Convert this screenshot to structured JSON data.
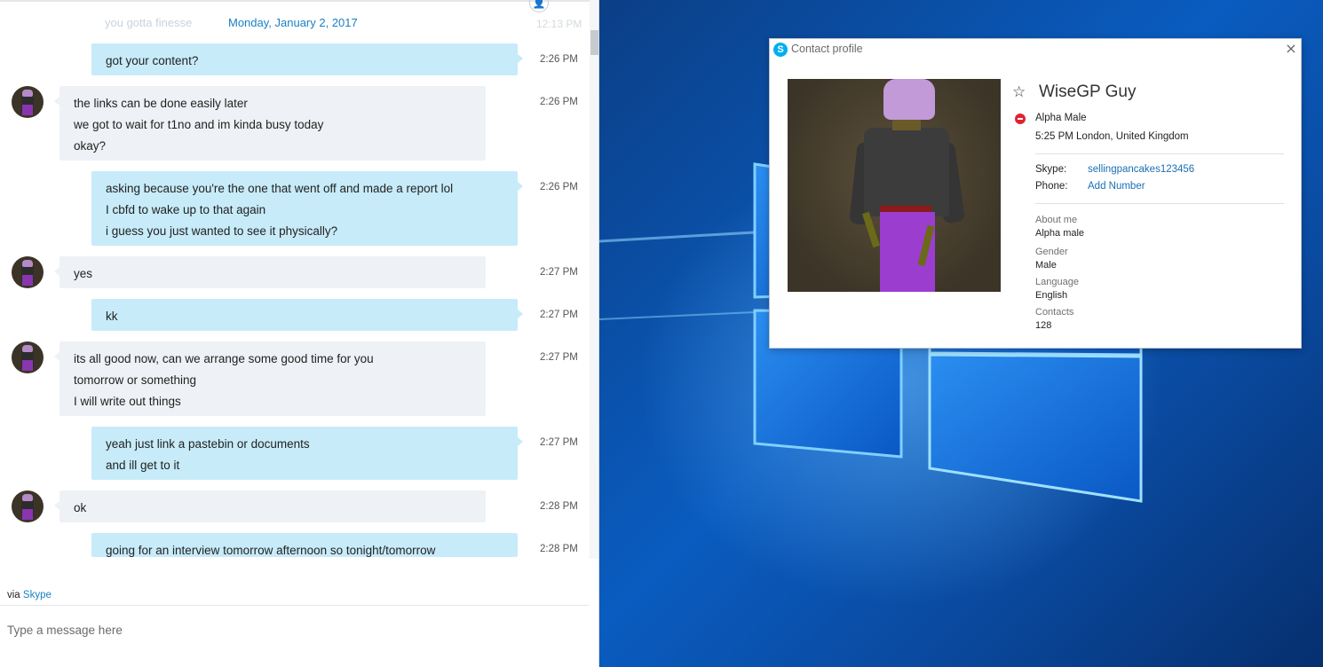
{
  "chat": {
    "faded_message": "you gotta finesse",
    "faded_time": "12:13 PM",
    "date_separator": "Monday, January 2, 2017",
    "messages": [
      {
        "dir": "out",
        "lines": [
          "got your content?"
        ],
        "time": "2:26 PM"
      },
      {
        "dir": "in",
        "lines": [
          "the links can be done easily later",
          "we got to wait for t1no and im kinda busy today",
          "okay?"
        ],
        "time": "2:26 PM"
      },
      {
        "dir": "out",
        "lines": [
          "asking because you're the one that went off and made a report lol",
          "I cbfd to wake up to that again",
          "i guess you just wanted to see it physically?"
        ],
        "time": "2:26 PM"
      },
      {
        "dir": "in",
        "lines": [
          "yes"
        ],
        "time": "2:27 PM"
      },
      {
        "dir": "out",
        "lines": [
          "kk"
        ],
        "time": "2:27 PM"
      },
      {
        "dir": "in",
        "lines": [
          "its all good now, can we arrange some good time for you",
          "tomorrow or something",
          "I will write out things"
        ],
        "time": "2:27 PM"
      },
      {
        "dir": "out",
        "lines": [
          "yeah just link a pastebin or documents",
          "and ill get to it"
        ],
        "time": "2:27 PM"
      },
      {
        "dir": "in",
        "lines": [
          "ok"
        ],
        "time": "2:28 PM"
      },
      {
        "dir": "out",
        "lines": [
          "going for an interview tomorrow afternoon so tonight/tomorrow"
        ],
        "time": "2:28 PM"
      }
    ],
    "via_prefix": "via",
    "via_link": "Skype",
    "input_placeholder": "Type a message here"
  },
  "profile": {
    "window_title": "Contact profile",
    "close_glyph": "×",
    "favorite_icon": "☆",
    "display_name": "WiseGP Guy",
    "status_color": "#e0242f",
    "mood": "Alpha Male",
    "local_time": "5:25 PM London, United Kingdom",
    "skype_label": "Skype:",
    "skype_id": "sellingpancakes123456",
    "phone_label": "Phone:",
    "phone_action": "Add Number",
    "about_label": "About me",
    "about_value": "Alpha male",
    "gender_label": "Gender",
    "gender_value": "Male",
    "language_label": "Language",
    "language_value": "English",
    "contacts_label": "Contacts",
    "contacts_value": "128"
  }
}
